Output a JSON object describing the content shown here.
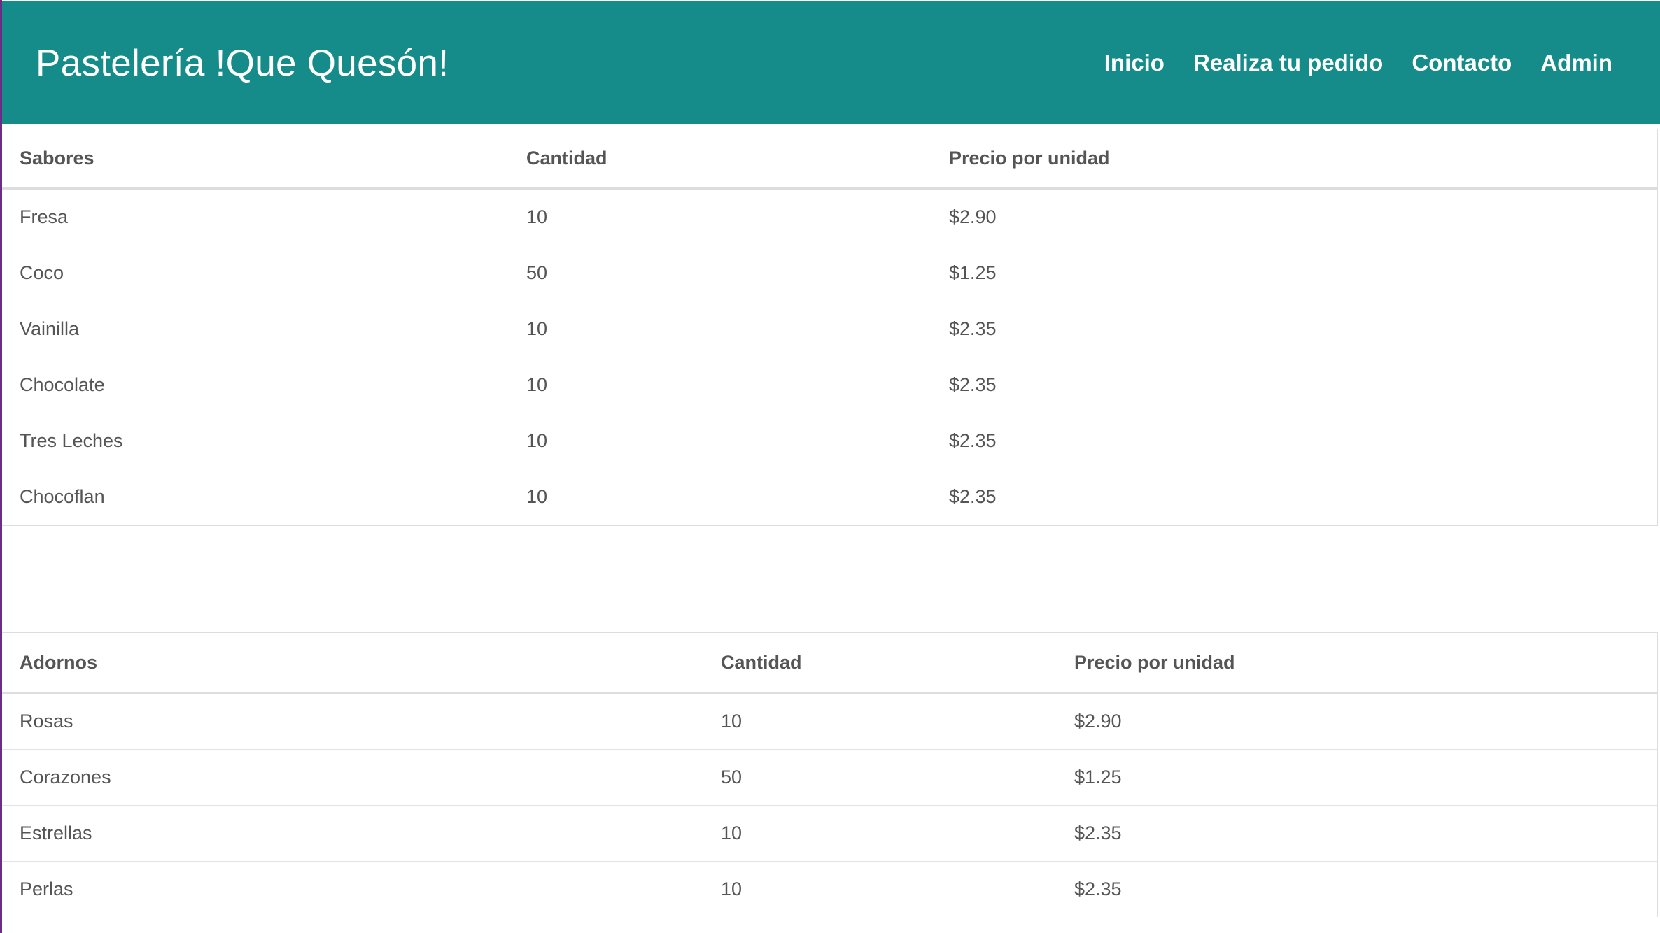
{
  "header": {
    "brand": "Pastelería !Que Quesón!",
    "nav": [
      {
        "label": "Inicio"
      },
      {
        "label": "Realiza tu pedido"
      },
      {
        "label": "Contacto"
      },
      {
        "label": "Admin"
      }
    ]
  },
  "sabores_table": {
    "headers": [
      "Sabores",
      "Cantidad",
      "Precio por unidad"
    ],
    "rows": [
      [
        "Fresa",
        "10",
        "$2.90"
      ],
      [
        "Coco",
        "50",
        "$1.25"
      ],
      [
        "Vainilla",
        "10",
        "$2.35"
      ],
      [
        "Chocolate",
        "10",
        "$2.35"
      ],
      [
        "Tres Leches",
        "10",
        "$2.35"
      ],
      [
        "Chocoflan",
        "10",
        "$2.35"
      ]
    ]
  },
  "adornos_table": {
    "headers": [
      "Adornos",
      "Cantidad",
      "Precio por unidad"
    ],
    "rows": [
      [
        "Rosas",
        "10",
        "$2.90"
      ],
      [
        "Corazones",
        "50",
        "$1.25"
      ],
      [
        "Estrellas",
        "10",
        "$2.35"
      ],
      [
        "Perlas",
        "10",
        "$2.35"
      ]
    ]
  },
  "colors": {
    "navbar_bg": "#158c8a",
    "text": "#555555",
    "border": "#dddddd"
  }
}
